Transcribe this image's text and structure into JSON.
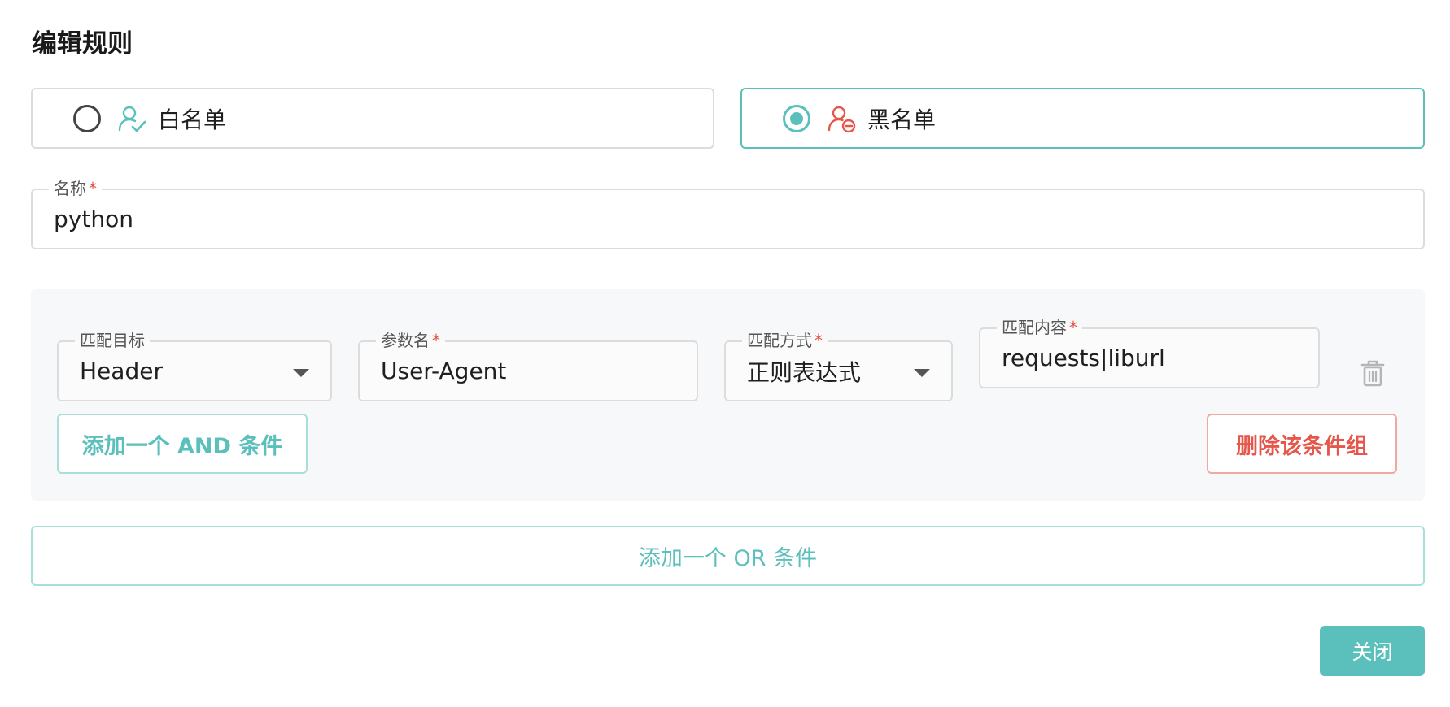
{
  "dialog": {
    "title": "编辑规则"
  },
  "rule_type": {
    "options": [
      {
        "label": "白名单",
        "icon": "user-check-icon",
        "selected": false
      },
      {
        "label": "黑名单",
        "icon": "user-block-icon",
        "selected": true
      }
    ]
  },
  "name_field": {
    "label": "名称",
    "required_mark": "*",
    "value": "python"
  },
  "condition_group": {
    "target": {
      "label": "匹配目标",
      "value": "Header"
    },
    "param": {
      "label": "参数名",
      "required_mark": "*",
      "value": "User-Agent"
    },
    "method": {
      "label": "匹配方式",
      "required_mark": "*",
      "value": "正则表达式"
    },
    "content": {
      "label": "匹配内容",
      "required_mark": "*",
      "value": "requests|liburl"
    },
    "add_and_label": "添加一个 AND 条件",
    "delete_group_label": "删除该条件组"
  },
  "add_or_label": "添加一个 OR 条件",
  "close_label": "关闭",
  "colors": {
    "accent": "#5bc0bb",
    "danger": "#e5574b",
    "required": "#e74c3c",
    "group_bg": "#f7f8fa"
  }
}
